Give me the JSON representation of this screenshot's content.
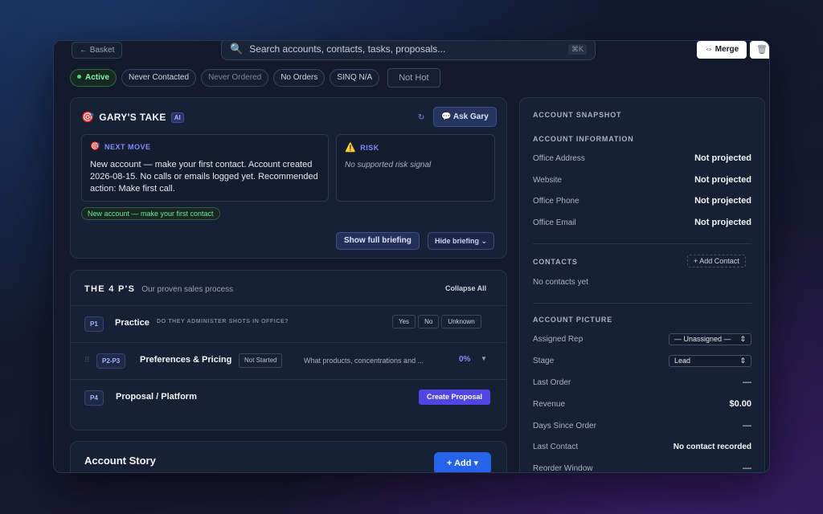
{
  "toolbar": {
    "back_label": "← Basket",
    "search_placeholder": "Search accounts, contacts, tasks, proposals...",
    "search_shortcut": "⌘K",
    "merge_label": "⇔ Merge"
  },
  "status_pills": [
    {
      "label": "Active"
    },
    {
      "label": "Never Contacted"
    },
    {
      "label": "Never Ordered"
    },
    {
      "label": "No Orders"
    },
    {
      "label": "SINQ N/A"
    },
    {
      "label": "Not Hot"
    }
  ],
  "gary": {
    "title": "GARY'S TAKE",
    "badge": "AI",
    "ask_label": "💬 Ask Gary",
    "next_move_label": "NEXT MOVE",
    "next_move_text": "New account — make your first contact. Account created 2026-08-15. No calls or emails logged yet. Recommended action: Make first call.",
    "risk_label": "RISK",
    "risk_text": "No supported risk signal",
    "tag": "New account — make your first contact",
    "show_full_label": "Show full briefing",
    "hide_label": "Hide briefing ⌄"
  },
  "four_ps": {
    "title": "THE 4 P'S",
    "subtitle": "Our proven sales process",
    "collapse_label": "Collapse All",
    "rows": [
      {
        "badge": "P1",
        "name": "Practice",
        "question": "DO THEY ADMINISTER SHOTS IN OFFICE?",
        "options": [
          "Yes",
          "No",
          "Unknown"
        ]
      },
      {
        "badge": "P2-P3",
        "name": "Preferences & Pricing",
        "status": "Not Started",
        "description": "What products, concentrations and ...",
        "percent": "0%"
      },
      {
        "badge": "P4",
        "name": "Proposal / Platform",
        "action": "Create Proposal"
      }
    ]
  },
  "story": {
    "title": "Account Story",
    "add_label": "+ Add ▾"
  },
  "snapshot": {
    "title": "ACCOUNT SNAPSHOT",
    "info_title": "ACCOUNT INFORMATION",
    "info": [
      {
        "key": "Office Address",
        "value": "Not projected"
      },
      {
        "key": "Website",
        "value": "Not projected"
      },
      {
        "key": "Office Phone",
        "value": "Not projected"
      },
      {
        "key": "Office Email",
        "value": "Not projected"
      }
    ],
    "contacts_title": "CONTACTS",
    "add_contact_label": "+ Add Contact",
    "no_contacts": "No contacts yet",
    "picture_title": "ACCOUNT PICTURE",
    "assigned_rep_label": "Assigned Rep",
    "assigned_rep_value": "— Unassigned —",
    "stage_label": "Stage",
    "stage_value": "Lead",
    "picture": [
      {
        "key": "Last Order",
        "value": "—"
      },
      {
        "key": "Revenue",
        "value": "$0.00"
      },
      {
        "key": "Days Since Order",
        "value": "—"
      },
      {
        "key": "Last Contact",
        "value": "No contact recorded"
      },
      {
        "key": "Reorder Window",
        "value": "—"
      }
    ]
  }
}
